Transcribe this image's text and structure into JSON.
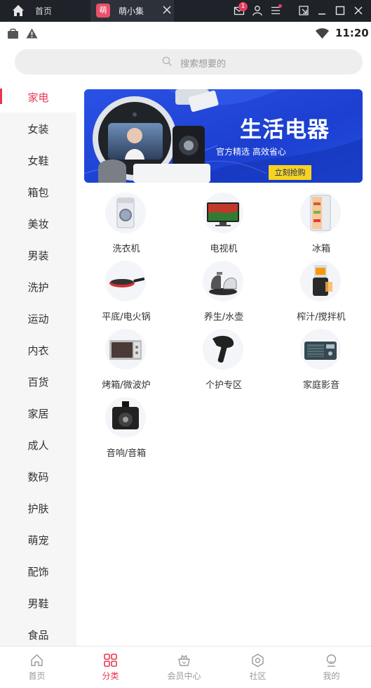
{
  "window": {
    "home_label": "首页",
    "tab_icon_text": "萌",
    "tab_label": "萌小集",
    "notification_count": "1"
  },
  "status_bar": {
    "time": "11:20"
  },
  "search": {
    "placeholder": "搜索想要的"
  },
  "sidebar": {
    "active_index": 0,
    "items": [
      {
        "label": "家电"
      },
      {
        "label": "女装"
      },
      {
        "label": "女鞋"
      },
      {
        "label": "箱包"
      },
      {
        "label": "美妆"
      },
      {
        "label": "男装"
      },
      {
        "label": "洗护"
      },
      {
        "label": "运动"
      },
      {
        "label": "内衣"
      },
      {
        "label": "百货"
      },
      {
        "label": "家居"
      },
      {
        "label": "成人"
      },
      {
        "label": "数码"
      },
      {
        "label": "护肤"
      },
      {
        "label": "萌宠"
      },
      {
        "label": "配饰"
      },
      {
        "label": "男鞋"
      },
      {
        "label": "食品"
      }
    ]
  },
  "banner": {
    "title": "生活电器",
    "subtitle": "官方精选 高效省心",
    "button": "立刻抢购"
  },
  "products": [
    {
      "label": "洗衣机",
      "icon": "washing-machine"
    },
    {
      "label": "电视机",
      "icon": "television"
    },
    {
      "label": "冰箱",
      "icon": "refrigerator"
    },
    {
      "label": "平底/电火锅",
      "icon": "frying-pan"
    },
    {
      "label": "养生/水壶",
      "icon": "kettle"
    },
    {
      "label": "榨汁/搅拌机",
      "icon": "juicer"
    },
    {
      "label": "烤箱/微波炉",
      "icon": "microwave"
    },
    {
      "label": "个护专区",
      "icon": "hair-dryer"
    },
    {
      "label": "家庭影音",
      "icon": "radio"
    },
    {
      "label": "音响/音箱",
      "icon": "speaker"
    }
  ],
  "tabbar": {
    "active_index": 1,
    "items": [
      {
        "label": "首页",
        "icon": "home"
      },
      {
        "label": "分类",
        "icon": "grid"
      },
      {
        "label": "会员中心",
        "icon": "crown-basket"
      },
      {
        "label": "社区",
        "icon": "hexagon"
      },
      {
        "label": "我的",
        "icon": "person"
      }
    ]
  },
  "colors": {
    "accent": "#e9364f",
    "banner_bg": "#1f43d0",
    "banner_button": "#f7d321"
  }
}
